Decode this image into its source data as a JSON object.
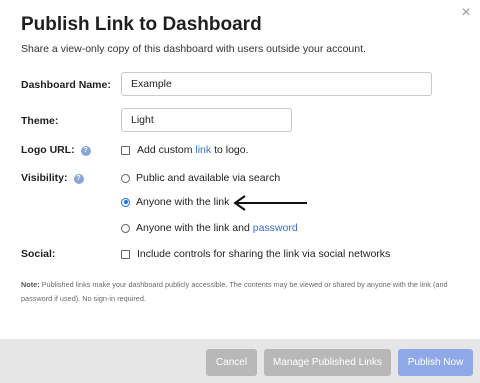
{
  "dialog": {
    "title": "Publish Link to Dashboard",
    "subtitle": "Share a view-only copy of this dashboard with users outside your account.",
    "close_icon": "×"
  },
  "fields": {
    "name_label": "Dashboard Name:",
    "name_value": "Example",
    "theme_label": "Theme:",
    "theme_value": "Light",
    "logo_label": "Logo URL:",
    "logo_text_before": "Add custom",
    "logo_link": "link",
    "logo_text_after": "to logo.",
    "visibility_label": "Visibility:",
    "visibility_options": [
      "Public and available via search",
      "Anyone with the link",
      "Anyone with the link and"
    ],
    "visibility_password_link": "password",
    "visibility_selected": "Anyone with the link",
    "social_label": "Social:",
    "social_option": "Include controls for sharing the link via social networks",
    "help_icon": "?"
  },
  "note": {
    "prefix": "Note:",
    "text": "Published links make your dashboard publicly accessible. The contents may be viewed or shared by anyone with the link (and password if used). No sign-in required."
  },
  "footer": {
    "cancel_label": "Cancel",
    "manage_label": "Manage Published Links",
    "publish_label": "Publish Now"
  },
  "colors": {
    "primary_button": "#8fa9e8",
    "secondary_button": "#b8b8b8",
    "link": "#3b6fc6"
  }
}
